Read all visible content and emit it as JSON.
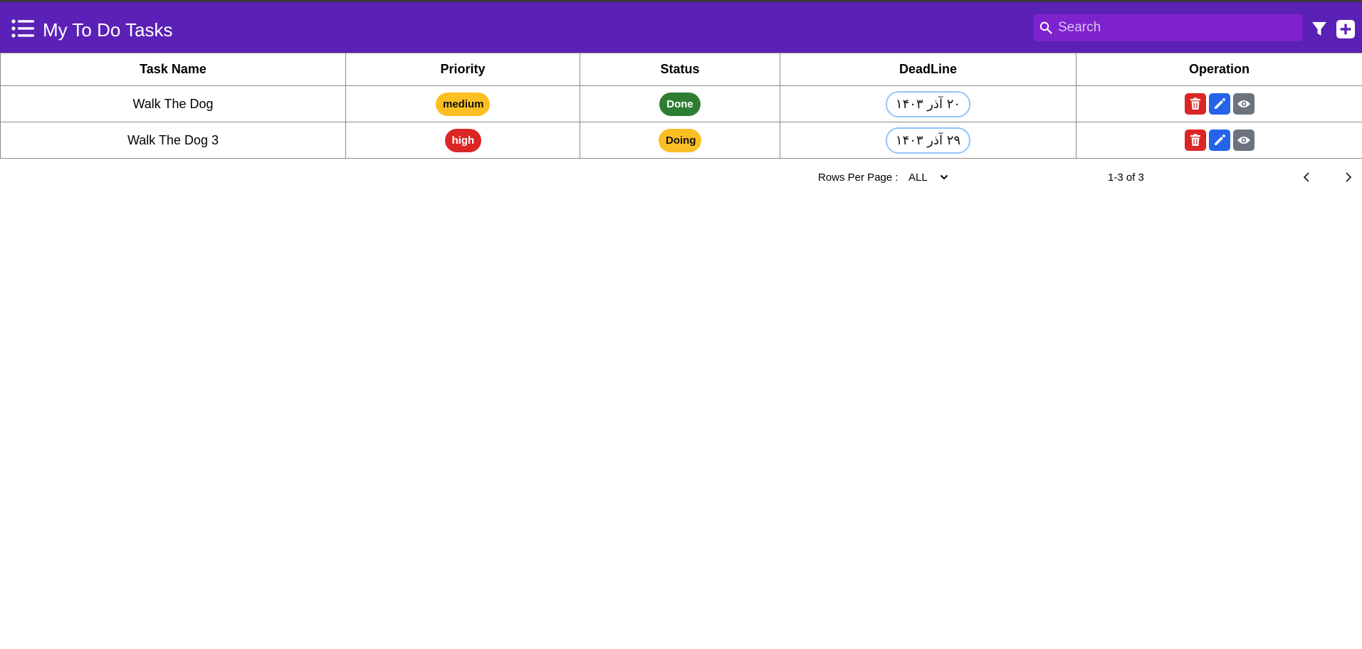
{
  "app": {
    "title": "My To Do Tasks",
    "brand_color": "#5b21b6",
    "search_placeholder": "Search"
  },
  "icons": {
    "menu": "list-menu-icon",
    "search": "search-icon",
    "filter": "filter-icon",
    "add": "plus-icon",
    "delete": "trash-icon",
    "edit": "pencil-icon",
    "view": "eye-icon",
    "prev": "chevron-left-icon",
    "next": "chevron-right-icon"
  },
  "table": {
    "headers": [
      "Task Name",
      "Priority",
      "Status",
      "DeadLine",
      "Operation"
    ],
    "rows": [
      {
        "name": "Walk The Dog",
        "priority": "medium",
        "status": "Done",
        "deadline": "۲۰ آذر ۱۴۰۳"
      },
      {
        "name": "Walk The Dog 3",
        "priority": "high",
        "status": "Doing",
        "deadline": "۲۹ آذر ۱۴۰۳"
      }
    ]
  },
  "pagination": {
    "rows_per_page_label": "Rows Per Page :",
    "rows_per_page_value": "ALL",
    "range_text": "1-3 of 3"
  },
  "colors": {
    "medium": "#fbbf24",
    "high": "#dc2626",
    "done": "#2e7d32",
    "doing": "#fbbf24",
    "delete": "#dc2626",
    "edit": "#2563eb",
    "view": "#6b7280"
  }
}
